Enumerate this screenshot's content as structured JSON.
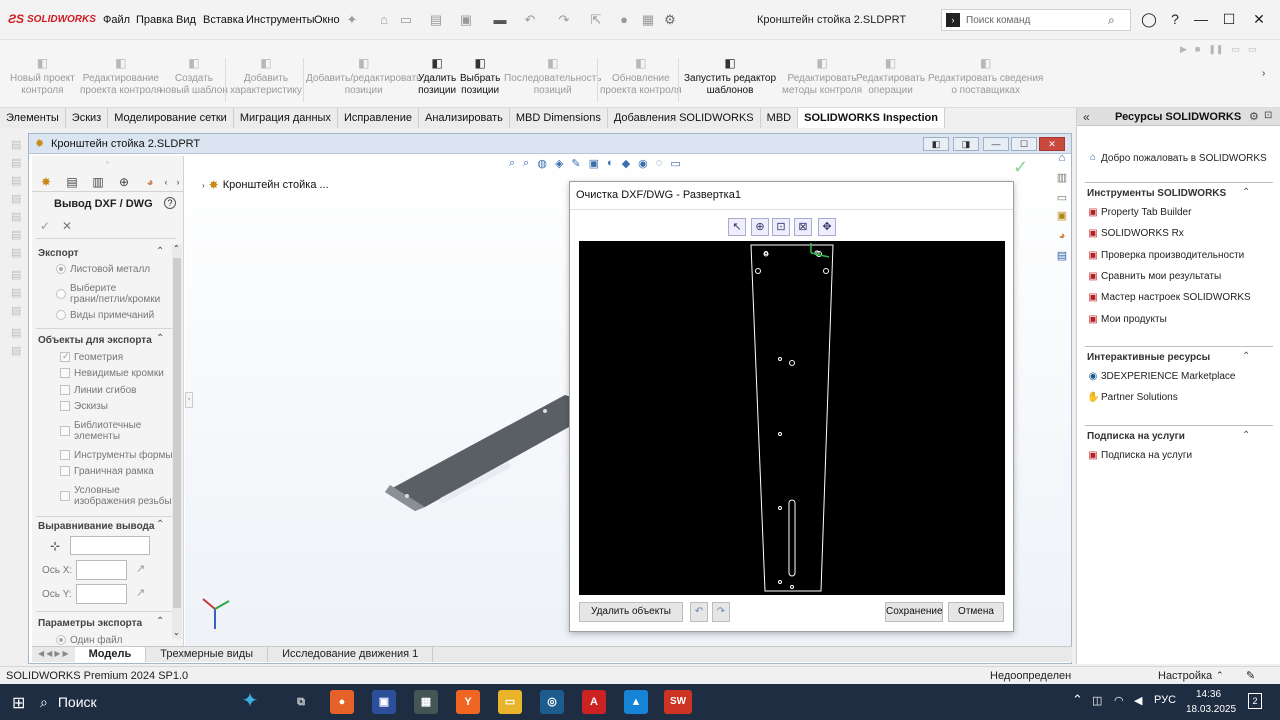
{
  "app": {
    "brand": "SOLIDWORKS",
    "doc_title": "Кронштейн стойка 2.SLDPRT",
    "menu": [
      "Файл",
      "Правка",
      "Вид",
      "Вставка",
      "Инструменты",
      "Окно"
    ],
    "search_placeholder": "Поиск команд"
  },
  "ribbon": {
    "buttons": [
      {
        "label1": "Новый проект",
        "label2": "контроля",
        "enabled": false,
        "icon": "document-new-icon"
      },
      {
        "label1": "Редактирование",
        "label2": "проекта контроля",
        "enabled": false,
        "icon": "edit-project-icon"
      },
      {
        "label1": "Создать",
        "label2": "новый шаблон",
        "enabled": false,
        "icon": "new-template-icon"
      },
      {
        "label1": "Добавить",
        "label2": "характеристику",
        "enabled": false,
        "icon": "add-characteristic-icon"
      },
      {
        "label1": "Добавить/редактировать",
        "label2": "позиции",
        "enabled": false,
        "icon": "add-balloon-icon"
      },
      {
        "label1": "Удалить",
        "label2": "позиции",
        "enabled": true,
        "icon": "remove-balloon-icon"
      },
      {
        "label1": "Выбрать",
        "label2": "позиции",
        "enabled": true,
        "icon": "select-balloon-icon"
      },
      {
        "label1": "Последовательность",
        "label2": "позиций",
        "enabled": false,
        "icon": "sequence-icon"
      },
      {
        "label1": "Обновление",
        "label2": "проекта контроля",
        "enabled": false,
        "icon": "update-icon"
      },
      {
        "label1": "Запустить редактор",
        "label2": "шаблонов",
        "enabled": true,
        "icon": "template-editor-icon"
      },
      {
        "label1": "Редактировать",
        "label2": "методы контроля",
        "enabled": false,
        "icon": "edit-methods-icon"
      },
      {
        "label1": "Редактировать",
        "label2": "операции",
        "enabled": false,
        "icon": "edit-operations-icon"
      },
      {
        "label1": "Редактировать сведения",
        "label2": "о поставщиках",
        "enabled": false,
        "icon": "edit-vendors-icon"
      }
    ]
  },
  "tabs": [
    "Элементы",
    "Эскиз",
    "Моделирование сетки",
    "Миграция данных",
    "Исправление",
    "Анализировать",
    "MBD Dimensions",
    "Добавления SOLIDWORKS",
    "MBD",
    "SOLIDWORKS Inspection"
  ],
  "active_tab": "SOLIDWORKS Inspection",
  "docwin": {
    "title": "Кронштейн стойка 2.SLDPRT"
  },
  "property_manager": {
    "title": "Вывод DXF / DWG",
    "sections": {
      "export": {
        "title": "Экспорт",
        "options": [
          {
            "label": "Листовой металл",
            "checked": true
          },
          {
            "label": "Выберите",
            "label2": "грани/петли/кромки",
            "checked": false
          },
          {
            "label": "Виды примечаний",
            "checked": false
          }
        ]
      },
      "objects": {
        "title": "Объекты для экспорта",
        "items": [
          {
            "label": "Геометрия",
            "checked": true
          },
          {
            "label": "Невидимые кромки",
            "checked": false
          },
          {
            "label": "Линии сгибов",
            "checked": false
          },
          {
            "label": "Эскизы",
            "checked": false
          },
          {
            "label": "Библиотечные",
            "label2": "элементы",
            "checked": false
          },
          {
            "label": "Инструменты формы",
            "checked": false
          },
          {
            "label": "Граничная рамка",
            "checked": false
          },
          {
            "label": "Условные",
            "label2": "изображения резьбы",
            "checked": false
          }
        ]
      },
      "alignment": {
        "title": "Выравнивание вывода",
        "axis_x": "Ось X:",
        "axis_y": "Ось Y:"
      },
      "params": {
        "title": "Параметры экспорта",
        "first": "Один файл"
      }
    }
  },
  "tree": {
    "root": "Кронштейн стойка ..."
  },
  "dialog": {
    "title": "Очистка DXF/DWG - Развертка1",
    "delete_label": "Удалить объекты",
    "save_label": "Сохранение",
    "cancel_label": "Отмена"
  },
  "model_tabs": [
    "Модель",
    "Трехмерные виды",
    "Исследование движения 1"
  ],
  "task_pane": {
    "title": "Ресурсы SOLIDWORKS",
    "welcome": "Добро пожаловать в SOLIDWORKS",
    "sections": [
      {
        "title": "Инструменты SOLIDWORKS",
        "items": [
          "Property Tab Builder",
          "SOLIDWORKS Rx",
          "Проверка производительности",
          "Сравнить мои результаты",
          "Мастер настроек SOLIDWORKS",
          "Мои продукты"
        ]
      },
      {
        "title": "Интерактивные ресурсы",
        "items": [
          "3DEXPERIENCE Marketplace",
          "Partner Solutions"
        ]
      },
      {
        "title": "Подписка на услуги",
        "items": [
          "Подписка на услуги"
        ]
      }
    ]
  },
  "status": {
    "version": "SOLIDWORKS Premium 2024 SP1.0",
    "state": "Недоопределен",
    "settings": "Настройка"
  },
  "taskbar": {
    "search": "Поиск",
    "lang": "РУС",
    "time": "14:36",
    "date": "18.03.2025",
    "notifications": "2"
  },
  "colors": {
    "brand_red": "#d01b20",
    "taskbar": "#1f2d42",
    "canvas": "#000000"
  }
}
